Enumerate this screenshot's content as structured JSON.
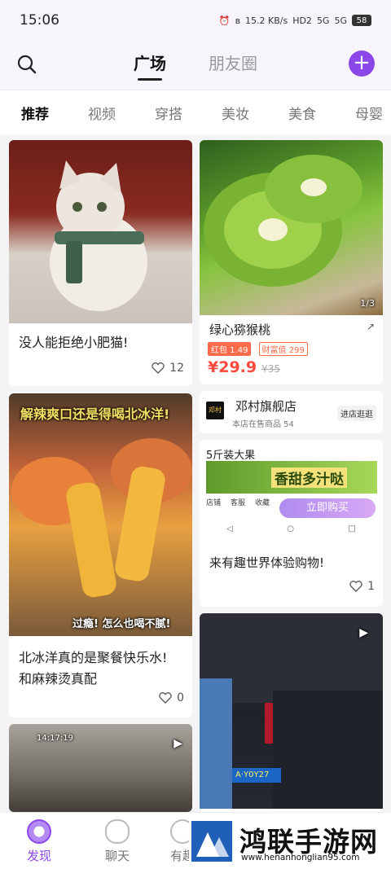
{
  "status_bar": {
    "time": "15:06",
    "net_speed": "15.2 KB/s",
    "hd": "HD2",
    "sig1": "5G",
    "sig2": "5G",
    "battery": "58"
  },
  "header": {
    "tabs": [
      {
        "label": "广场"
      },
      {
        "label": "朋友圈"
      }
    ]
  },
  "categories": [
    "推荐",
    "视频",
    "穿搭",
    "美妆",
    "美食",
    "母婴"
  ],
  "feed": {
    "cat_post": {
      "title": "没人能拒绝小肥猫!",
      "likes": "12"
    },
    "kiwi_ad": {
      "page": "1/3",
      "title": "绿心猕猴桃",
      "tag1": "红包 1.49",
      "tag2": "财富值 299",
      "price": "¥29.9",
      "orig_price": "¥35",
      "shop_logo": "邓村",
      "shop_name": "邓村旗舰店",
      "shop_count": "本店在售商品 54",
      "shop_btn": "进店逛逛",
      "banner_label": "5斤装大果",
      "banner_text": "香甜多汁哒",
      "btns": [
        "店铺",
        "客服",
        "收藏"
      ],
      "buy_btn": "立即购买",
      "title2": "来有趣世界体验购物!",
      "likes": "1"
    },
    "drink_post": {
      "overlay_top": "解辣爽口还是得喝北冰洋!",
      "overlay_bottom": "过瘾! 怎么也喝不腻!",
      "title": "北冰洋真的是聚餐快乐水! 和麻辣烫真配",
      "likes": "0"
    },
    "alley_post": {
      "time_overlay": "14:17:19"
    },
    "night_post": {
      "plate": "A·Y0Y27"
    }
  },
  "bottom_nav": [
    {
      "label": "发现"
    },
    {
      "label": "聊天"
    },
    {
      "label": "有趣"
    }
  ],
  "watermark": {
    "name": "鸿联手游网",
    "url": "www.henanhonglian95.com"
  },
  "colors": {
    "accent": "#8b47e8",
    "price": "#ff4a3d"
  }
}
